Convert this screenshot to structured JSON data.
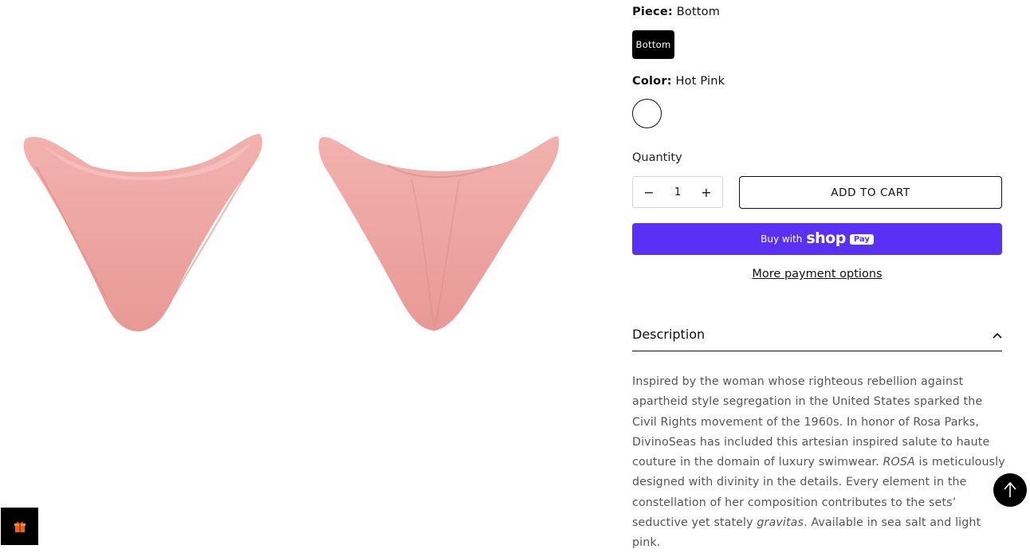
{
  "piece": {
    "label": "Piece:",
    "value": "Bottom",
    "option": "Bottom"
  },
  "color": {
    "label": "Color:",
    "value": "Hot Pink"
  },
  "quantity": {
    "label": "Quantity",
    "value": "1",
    "minus": "−",
    "plus": "+"
  },
  "add_to_cart": "ADD TO CART",
  "shop_pay": {
    "prefix": "Buy with",
    "brand": "shop",
    "badge": "Pay",
    "color": "#5a31f4"
  },
  "more_payment": "More payment options",
  "description": {
    "title": "Description",
    "intro": "Inspired by the woman whose righteous rebellion against apartheid style segregation in the United States sparked the Civil Rights movement of the 1960s. In honor of Rosa Parks, DivinoSeas has included this artesian inspired salute to haute couture in the domain of luxury swimwear. ",
    "rosa": "ROSA",
    "mid": " is meticulously designed with divinity in the details. Every element in the constellation of her composition contributes to the sets’ seductive yet stately ",
    "gravitas": "gravitas",
    "end": ". Available in sea salt and light pink."
  },
  "icons": {
    "chevron": "chevron-up-icon",
    "back_to_top": "arrow-up-icon",
    "gift": "gift-icon"
  },
  "product_color": "#eda3a1"
}
